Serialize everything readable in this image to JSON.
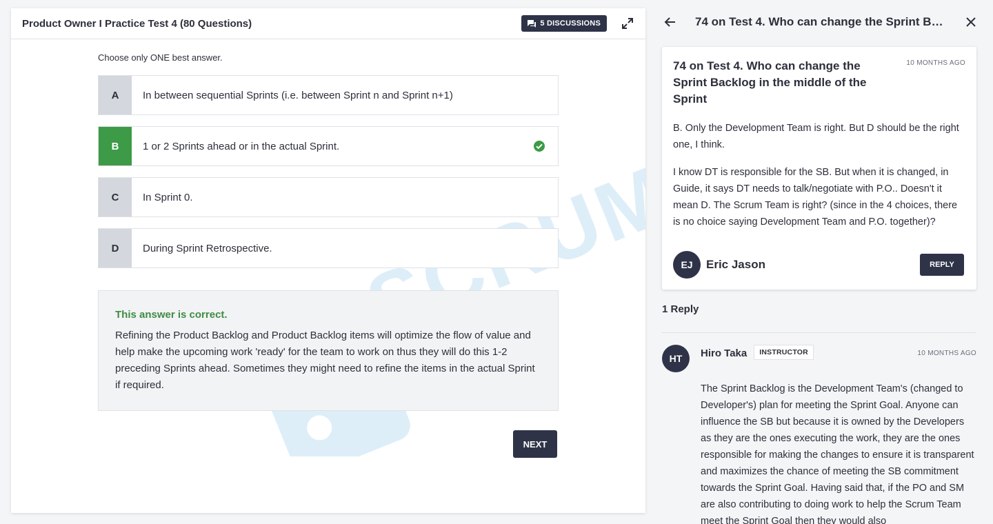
{
  "quiz": {
    "title": "Product Owner I Practice Test 4 (80 Questions)",
    "discussions_label": "5 DISCUSSIONS",
    "instruction": "Choose only ONE best answer.",
    "options": [
      {
        "letter": "A",
        "text": "In between sequential Sprints (i.e. between Sprint n and Sprint n+1)"
      },
      {
        "letter": "B",
        "text": "1 or 2 Sprints ahead or in the actual Sprint."
      },
      {
        "letter": "C",
        "text": "In Sprint 0."
      },
      {
        "letter": "D",
        "text": "During Sprint Retrospective."
      }
    ],
    "feedback": {
      "title": "This answer is correct.",
      "text": "Refining the Product Backlog and Product Backlog items will optimize the flow of value and help make the upcoming work 'ready' for the team to work on thus they will do this 1-2 preceding Sprints ahead. Sometimes they might need to refine the items in the actual Sprint if required."
    },
    "next_label": "NEXT",
    "watermark": "SCRUMPREP"
  },
  "discussion": {
    "header_title": "74 on Test 4. Who can change the Sprint Bac...",
    "post": {
      "title": "74 on Test 4. Who can change the Sprint Backlog in the middle of the Sprint",
      "time": "10 MONTHS AGO",
      "paragraph1": "B. Only the Development Team is right. But D should be the right one, I think.",
      "paragraph2": "I know DT is responsible for the SB. But when it is changed, in Guide, it says DT needs to talk/negotiate with P.O.. Doesn't it mean D. The Scrum Team is right? (since in the 4 choices, there is  no choice saying Development Team and P.O. together)?",
      "author_initials": "EJ",
      "author_name": "Eric Jason",
      "reply_label": "REPLY"
    },
    "reply_count": "1 Reply",
    "reply": {
      "initials": "HT",
      "name": "Hiro Taka",
      "badge": "INSTRUCTOR",
      "time": "10 MONTHS AGO",
      "text": "The Sprint Backlog is the Development Team's (changed to Developer's) plan for meeting the Sprint Goal. Anyone can influence the SB but because it is owned by the Developers as they are the ones executing the work, they are the ones responsible for making the changes to ensure it is transparent and maximizes the chance of meeting the SB commitment towards the Sprint Goal. Having said that, if the PO and SM are also contributing to doing work to help the Scrum Team meet the Sprint Goal then they would also"
    }
  },
  "colors": {
    "primary_dark": "#2e3348",
    "correct_green": "#3d9a47",
    "option_letter_bg": "#d4d7de"
  }
}
